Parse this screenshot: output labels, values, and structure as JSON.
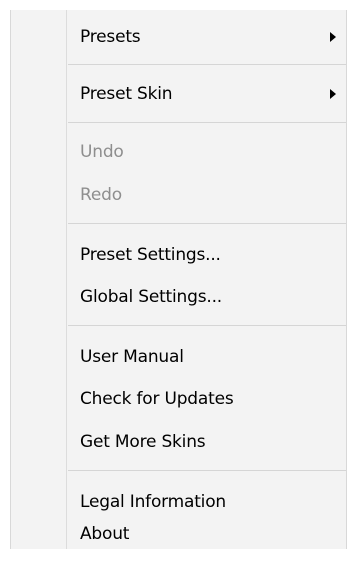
{
  "menu": {
    "items": [
      {
        "label": "Presets"
      },
      {
        "label": "Preset Skin"
      },
      {
        "label": "Undo"
      },
      {
        "label": "Redo"
      },
      {
        "label": "Preset Settings..."
      },
      {
        "label": "Global Settings..."
      },
      {
        "label": "User Manual"
      },
      {
        "label": "Check for Updates"
      },
      {
        "label": "Get More Skins"
      },
      {
        "label": "Legal Information"
      },
      {
        "label": "About"
      }
    ],
    "submenu_icon": "chevron-right-icon",
    "disabled_color": "#8e8e8e"
  }
}
